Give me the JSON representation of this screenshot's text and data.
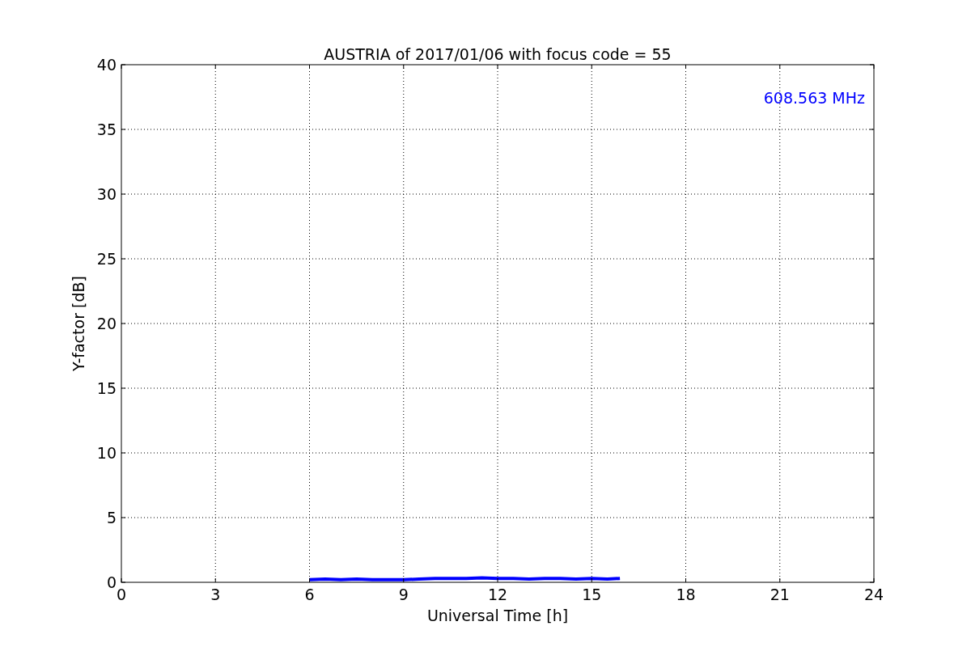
{
  "chart_data": {
    "type": "line",
    "title": "AUSTRIA of 2017/01/06 with focus code = 55",
    "xlabel": "Universal Time [h]",
    "ylabel": "Y-factor [dB]",
    "x": [
      6,
      6.5,
      7,
      7.5,
      8,
      8.5,
      9,
      9.5,
      10,
      10.5,
      11,
      11.5,
      12,
      12.5,
      13,
      13.5,
      14,
      14.5,
      15,
      15.5,
      15.9
    ],
    "series": [
      {
        "name": "608.563 MHz",
        "color": "#0000ff",
        "values": [
          0.2,
          0.25,
          0.2,
          0.25,
          0.2,
          0.2,
          0.2,
          0.25,
          0.3,
          0.3,
          0.3,
          0.35,
          0.3,
          0.3,
          0.25,
          0.3,
          0.3,
          0.25,
          0.3,
          0.25,
          0.3
        ]
      }
    ],
    "xlim": [
      0,
      24
    ],
    "ylim": [
      0,
      40
    ],
    "xticks": [
      0,
      3,
      6,
      9,
      12,
      15,
      18,
      21,
      24
    ],
    "yticks": [
      0,
      5,
      10,
      15,
      20,
      25,
      30,
      35,
      40
    ],
    "grid": true
  }
}
